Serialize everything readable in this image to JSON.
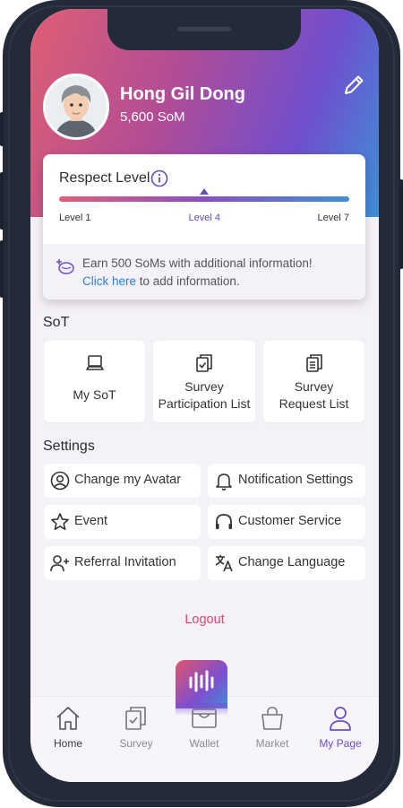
{
  "profile": {
    "name": "Hong Gil Dong",
    "som_balance": "5,600 SoM",
    "edit_icon": "pencil-icon"
  },
  "respect": {
    "title": "Respect Level",
    "min_label": "Level 1",
    "current_label": "Level 4",
    "max_label": "Level 7",
    "current_level": 4,
    "max_level": 7,
    "promo_text": "Earn 500 SoMs with additional information!",
    "promo_link": "Click here",
    "promo_suffix": " to add information."
  },
  "sot": {
    "title": "SoT",
    "tiles": [
      {
        "label": "My SoT",
        "icon": "laptop-icon"
      },
      {
        "label": "Survey\nParticipation List",
        "icon": "clipboard-check-icon"
      },
      {
        "label": "Survey\nRequest List",
        "icon": "clipboard-list-icon"
      }
    ]
  },
  "settings": {
    "title": "Settings",
    "items": [
      {
        "label": "Change my Avatar",
        "icon": "user-circle-icon"
      },
      {
        "label": "Notification Settings",
        "icon": "bell-icon"
      },
      {
        "label": "Event",
        "icon": "star-icon"
      },
      {
        "label": "Customer Service",
        "icon": "headset-icon"
      },
      {
        "label": "Referral Invitation",
        "icon": "user-plus-icon"
      },
      {
        "label": "Change Language",
        "icon": "translate-icon"
      }
    ]
  },
  "logout_label": "Logout",
  "tabbar": {
    "active": "My Page",
    "tabs": [
      {
        "label": "Home",
        "icon": "home-icon"
      },
      {
        "label": "Survey",
        "icon": "clipboard-check-icon"
      },
      {
        "label": "Wallet",
        "icon": "wallet-icon"
      },
      {
        "label": "Market",
        "icon": "shopping-bag-icon"
      },
      {
        "label": "My Page",
        "icon": "person-icon"
      }
    ]
  },
  "colors": {
    "accent": "#6a4fc6",
    "logout": "#d8496a",
    "link": "#2b7fd4"
  }
}
